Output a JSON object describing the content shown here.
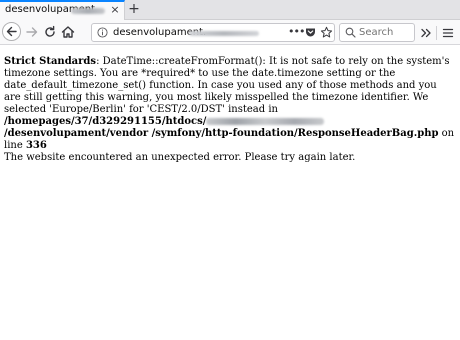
{
  "browser": {
    "tab": {
      "title": "desenvolupament.",
      "close_glyph": "×"
    },
    "new_tab_glyph": "+",
    "url": {
      "prefix": "desenvolupament.",
      "actions_glyph": "•••"
    },
    "search": {
      "placeholder": "Search"
    },
    "overflow_glyph": "»",
    "accent_color": "#0a84ff"
  },
  "error": {
    "level": "Strict Standards",
    "message": ": DateTime::createFromFormat(): It is not safe to rely on the system's timezone settings. You are *required* to use the date.timezone setting or the date_default_timezone_set() function. In case you used any of those methods and you are still getting this warning, you most likely misspelled the timezone identifier. We selected 'Europe/Berlin' for 'CEST/2.0/DST' instead in ",
    "path_start": "/homepages/37/d329291155/htdocs/",
    "path_end": "/desenvolupament/vendor /symfony/http-foundation/ResponseHeaderBag.php",
    "on_line_text": " on line ",
    "line_number": "336",
    "footer": "The website encountered an unexpected error. Please try again later."
  }
}
